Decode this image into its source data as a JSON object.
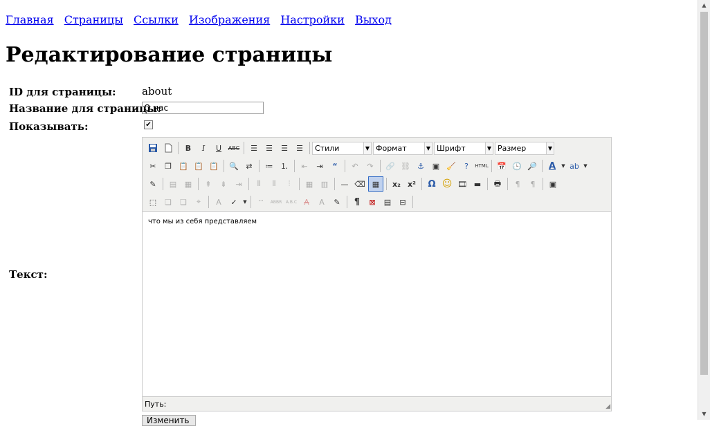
{
  "nav": [
    "Главная",
    "Страницы",
    "Ссылки",
    "Изображения",
    "Настройки",
    "Выход"
  ],
  "title": "Редактирование страницы",
  "form": {
    "id_label": "ID для страницы:",
    "id_value": "about",
    "name_label": "Название для страницы:",
    "name_value": "О нас",
    "show_label": "Показывать:",
    "show_checked": true,
    "text_label": "Текст:"
  },
  "editor": {
    "styles": "Стили",
    "format": "Формат",
    "font": "Шрифт",
    "size": "Размер",
    "content": "что мы из себя представляем",
    "path_label": "Путь:",
    "html_btn": "HTML"
  },
  "submit_label": "Изменить"
}
